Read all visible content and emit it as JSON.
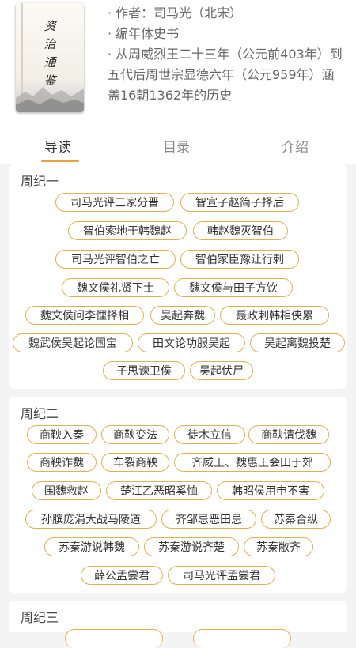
{
  "book": {
    "cover_title": "资治通鉴",
    "info": [
      "· 作者：司马光（北宋）",
      "· 编年体史书",
      "· 从周威烈王二十三年（公元前403年）到五代后周世宗显德六年（公元959年）涵盖16朝1362年的历史"
    ]
  },
  "tabs": [
    {
      "label": "导读",
      "active": true
    },
    {
      "label": "目录",
      "active": false
    },
    {
      "label": "介绍",
      "active": false
    }
  ],
  "accent_color": "#e8a23a",
  "chapters": [
    {
      "title": "周纪一",
      "rows": [
        [
          "司马光评三家分晋",
          "智宣子赵简子择后"
        ],
        [
          "智伯索地于韩魏赵",
          "韩赵魏灭智伯"
        ],
        [
          "司马光评智伯之亡",
          "智伯家臣豫让行刺"
        ],
        [
          "魏文侯礼贤下士",
          "魏文侯与田子方饮"
        ],
        [
          "魏文侯问李悝择相",
          "吴起奔魏",
          "聂政刺韩相侠累"
        ],
        [
          "魏武侯吴起论国宝",
          "田文论功服吴起",
          "吴起离魏投楚"
        ],
        [
          "子思谏卫侯",
          "吴起伏尸"
        ]
      ]
    },
    {
      "title": "周纪二",
      "rows": [
        [
          "商鞅入秦",
          "商鞅变法",
          "徒木立信",
          "商鞅请伐魏"
        ],
        [
          "商鞅诈魏",
          "车裂商鞅",
          "齐威王、魏惠王会田于郊"
        ],
        [
          "围魏救赵",
          "楚江乙恶昭奚恤",
          "韩昭侯用申不害"
        ],
        [
          "孙膑庞涓大战马陵道",
          "齐邹忌恶田忌",
          "苏秦合纵"
        ],
        [
          "苏秦游说韩魏",
          "苏秦游说齐楚",
          "苏秦敝齐"
        ],
        [
          "薛公孟尝君",
          "司马光评孟尝君"
        ]
      ]
    },
    {
      "title": "周纪三",
      "rows": []
    }
  ]
}
